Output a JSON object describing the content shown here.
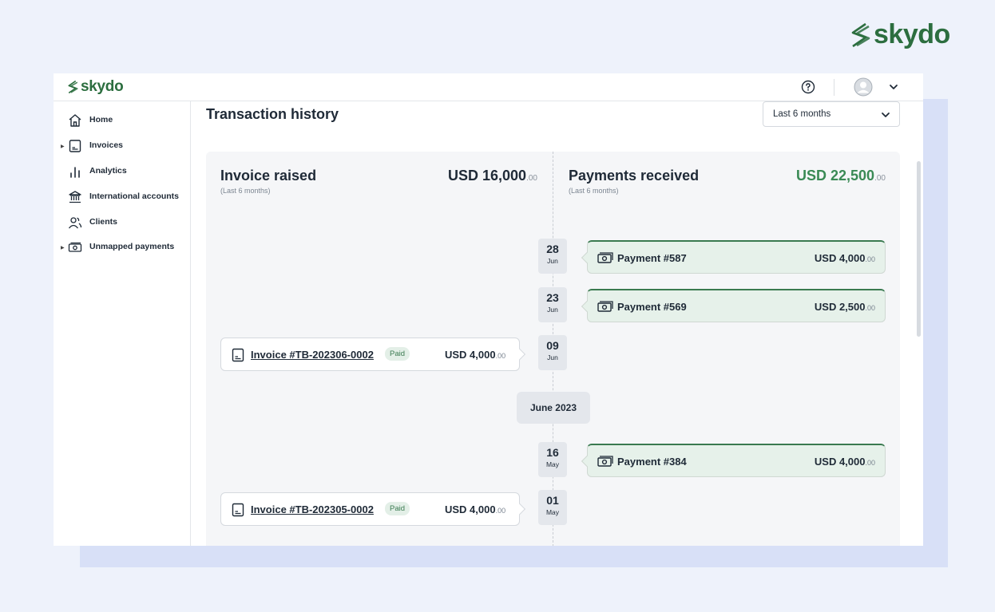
{
  "brand": {
    "name": "skydo",
    "color": "#2c6e3f"
  },
  "topbar": {
    "help_icon": "help-circle-icon",
    "avatar_icon": "user-avatar-icon",
    "menu_icon": "chevron-down-icon"
  },
  "sidebar": {
    "items": [
      {
        "label": "Home",
        "icon": "home-icon",
        "expandable": false
      },
      {
        "label": "Invoices",
        "icon": "invoice-icon",
        "expandable": true
      },
      {
        "label": "Analytics",
        "icon": "bar-chart-icon",
        "expandable": false
      },
      {
        "label": "International accounts",
        "icon": "bank-icon",
        "expandable": false
      },
      {
        "label": "Clients",
        "icon": "clients-icon",
        "expandable": false
      },
      {
        "label": "Unmapped payments",
        "icon": "cash-icon",
        "expandable": true
      }
    ]
  },
  "main": {
    "title": "Transaction history",
    "period_select": {
      "value": "Last 6 months"
    },
    "invoice_column": {
      "title": "Invoice raised",
      "subtitle": "(Last 6 months)",
      "amount": "USD 16,000",
      "cents": ".00"
    },
    "payment_column": {
      "title": "Payments received",
      "subtitle": "(Last 6 months)",
      "amount": "USD 22,500",
      "cents": ".00",
      "accent": "#3a8a55"
    },
    "timeline": [
      {
        "day": "28",
        "month": "Jun",
        "type": "payment",
        "label": "Payment #587",
        "amount": "USD 4,000",
        "cents": ".00"
      },
      {
        "day": "23",
        "month": "Jun",
        "type": "payment",
        "label": "Payment #569",
        "amount": "USD 2,500",
        "cents": ".00"
      },
      {
        "day": "09",
        "month": "Jun",
        "type": "invoice",
        "label": "Invoice #TB-202306-0002",
        "status": "Paid",
        "amount": "USD 4,000",
        "cents": ".00"
      },
      {
        "day": "16",
        "month": "May",
        "type": "payment",
        "label": "Payment #384",
        "amount": "USD 4,000",
        "cents": ".00"
      },
      {
        "day": "01",
        "month": "May",
        "type": "invoice",
        "label": "Invoice #TB-202305-0002",
        "status": "Paid",
        "amount": "USD 4,000",
        "cents": ".00"
      }
    ],
    "month_divider": "June 2023"
  }
}
